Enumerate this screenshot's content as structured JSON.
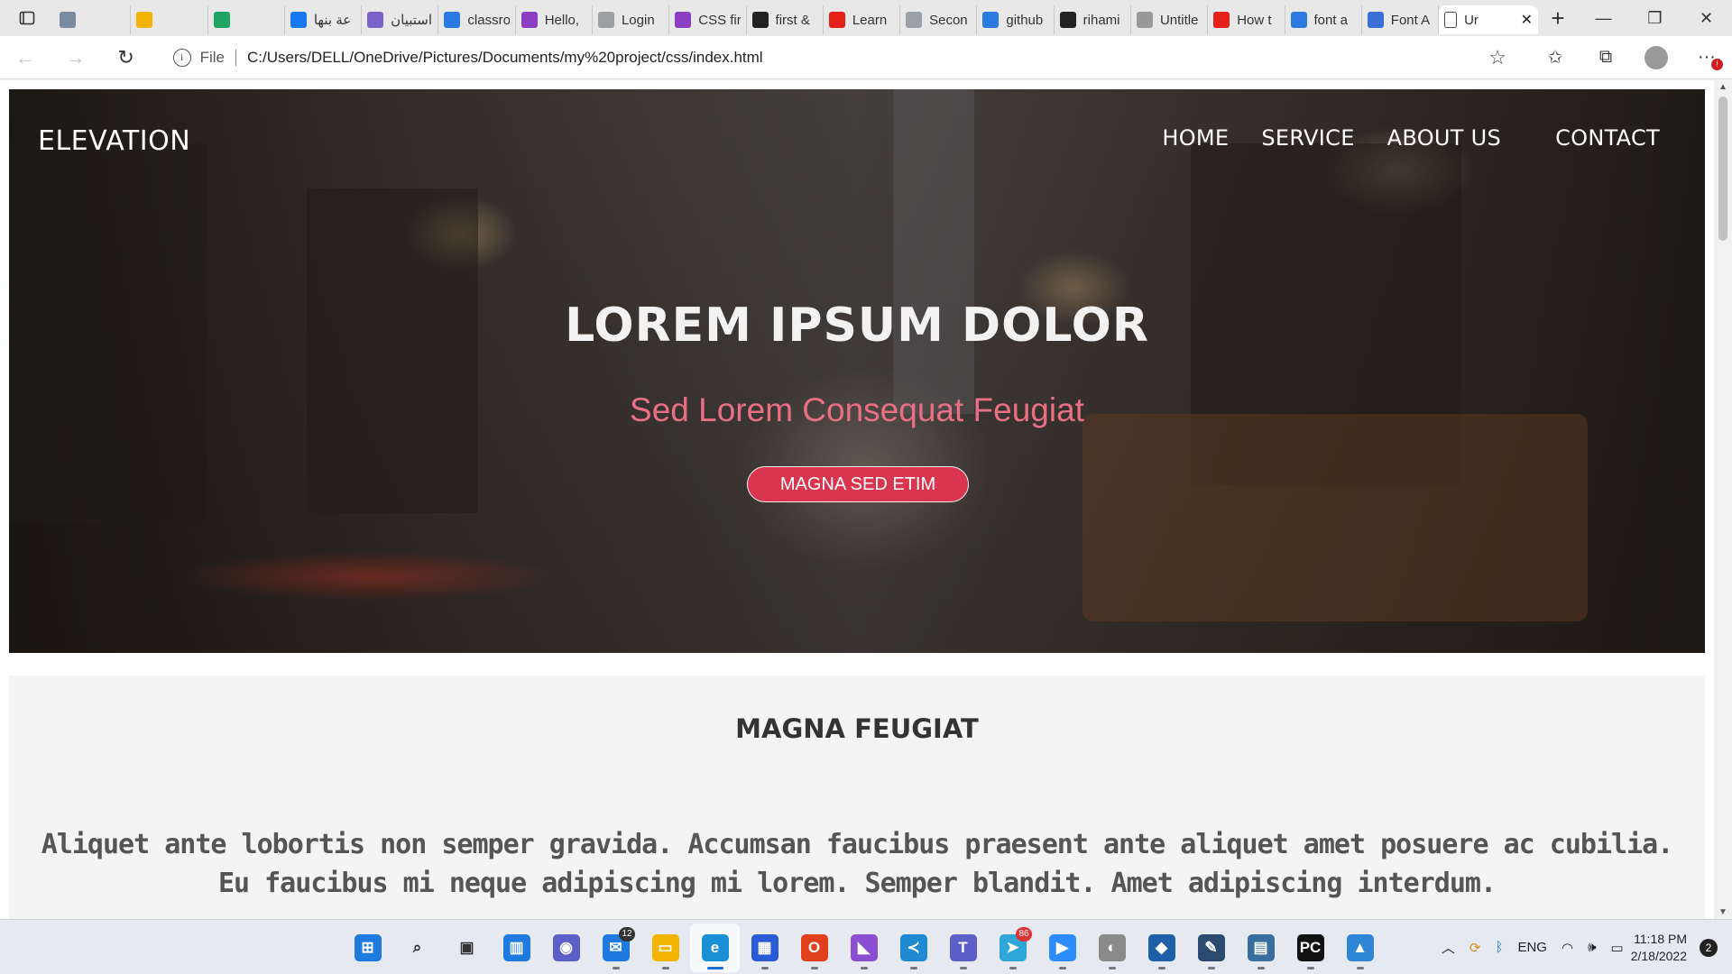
{
  "browser": {
    "tabs": [
      {
        "label": "",
        "icon": "calendar-icon",
        "color": "#7a8aa0"
      },
      {
        "label": "",
        "icon": "google-drive-icon",
        "color": "#f2b400"
      },
      {
        "label": "",
        "icon": "google-drive-icon",
        "color": "#1fa463"
      },
      {
        "label": "عة بنها",
        "icon": "facebook-icon",
        "color": "#1877f2"
      },
      {
        "label": "استبيان",
        "icon": "form-icon",
        "color": "#7b61c9"
      },
      {
        "label": "classro",
        "icon": "bing-icon",
        "color": "#2a7ae2"
      },
      {
        "label": "Hello,",
        "icon": "purple-app-icon",
        "color": "#8a3fc2"
      },
      {
        "label": "Login",
        "icon": "page-icon",
        "color": "#9aa0a6"
      },
      {
        "label": "CSS fir",
        "icon": "purple-app-icon",
        "color": "#8a3fc2"
      },
      {
        "label": "first &",
        "icon": "github-icon",
        "color": "#222222"
      },
      {
        "label": "Learn",
        "icon": "youtube-icon",
        "color": "#e62117"
      },
      {
        "label": "Secon",
        "icon": "page-icon",
        "color": "#9aa0a6"
      },
      {
        "label": "github",
        "icon": "bing-icon",
        "color": "#2a7ae2"
      },
      {
        "label": "rihami",
        "icon": "github-icon",
        "color": "#222222"
      },
      {
        "label": "Untitle",
        "icon": "rihal-icon",
        "color": "#999999"
      },
      {
        "label": "How t",
        "icon": "youtube-icon",
        "color": "#e62117"
      },
      {
        "label": "font a",
        "icon": "bing-icon",
        "color": "#2a7ae2"
      },
      {
        "label": "Font A",
        "icon": "flag-icon",
        "color": "#3b6fd6"
      }
    ],
    "active_tab": {
      "label": "Ur",
      "icon": "page-icon"
    },
    "address": {
      "scheme": "File",
      "url": "C:/Users/DELL/OneDrive/Pictures/Documents/my%20project/css/index.html"
    }
  },
  "site": {
    "logo": "ELEVATION",
    "nav": [
      "HOME",
      "SERVICE",
      "ABOUT US",
      "CONTACT"
    ],
    "hero": {
      "title": "LOREM IPSUM DOLOR",
      "subtitle": "Sed Lorem Consequat Feugiat",
      "button": "MAGNA SED ETIM"
    },
    "section": {
      "title": "MAGNA FEUGIAT",
      "text": "Aliquet ante lobortis non semper gravida. Accumsan faucibus praesent ante aliquet amet posuere ac cubilia. Eu faucibus mi neque adipiscing mi lorem. Semper blandit. Amet adipiscing interdum."
    }
  },
  "taskbar": {
    "apps": [
      {
        "name": "windows-start-icon",
        "color": "#1f7ae0",
        "glyph": "⊞"
      },
      {
        "name": "search-icon",
        "color": "#333333",
        "glyph": "⌕"
      },
      {
        "name": "task-view-icon",
        "color": "#333333",
        "glyph": "▣"
      },
      {
        "name": "widgets-icon",
        "color": "#1f7ae0",
        "glyph": "▥"
      },
      {
        "name": "teams-chat-icon",
        "color": "#5b5fc7",
        "glyph": "◉"
      },
      {
        "name": "mail-icon",
        "color": "#1f7ae0",
        "glyph": "✉",
        "badge": "12"
      },
      {
        "name": "file-explorer-icon",
        "color": "#f2b400",
        "glyph": "▭"
      },
      {
        "name": "edge-icon",
        "color": "#1b8fd6",
        "glyph": "e",
        "active": true
      },
      {
        "name": "store-icon",
        "color": "#2a5bd7",
        "glyph": "▦"
      },
      {
        "name": "office-icon",
        "color": "#e2401c",
        "glyph": "O"
      },
      {
        "name": "visual-studio-icon",
        "color": "#8a4fd3",
        "glyph": "◣"
      },
      {
        "name": "vscode-icon",
        "color": "#1f8ad2",
        "glyph": "≺"
      },
      {
        "name": "teams-icon",
        "color": "#5b5fc7",
        "glyph": "T"
      },
      {
        "name": "telegram-icon",
        "color": "#2ea6da",
        "glyph": "➤",
        "badge": "86",
        "badge_red": true
      },
      {
        "name": "zoom-icon",
        "color": "#2d8cff",
        "glyph": "▶"
      },
      {
        "name": "spotlight-icon",
        "color": "#8a8a8a",
        "glyph": "◐"
      },
      {
        "name": "virtualbox-icon",
        "color": "#1d5fa8",
        "glyph": "◆"
      },
      {
        "name": "drawing-app-icon",
        "color": "#2b4a6f",
        "glyph": "✎"
      },
      {
        "name": "python-ide-icon",
        "color": "#3a6e9e",
        "glyph": "▤"
      },
      {
        "name": "pycharm-icon",
        "color": "#111111",
        "glyph": "PC"
      },
      {
        "name": "photos-icon",
        "color": "#2f86d6",
        "glyph": "▲"
      }
    ],
    "tray": {
      "language": "ENG",
      "time": "11:18 PM",
      "date": "2/18/2022",
      "notifications": "2"
    }
  }
}
